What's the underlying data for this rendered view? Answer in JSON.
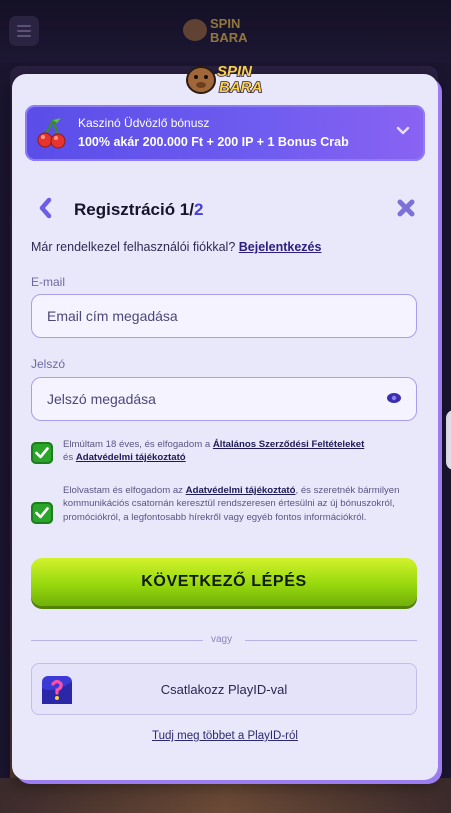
{
  "brand": {
    "logo_text_1": "SPIN",
    "logo_text_2": "BARA"
  },
  "bonus": {
    "title": "Kaszinó Üdvözlő bónusz",
    "description": "100% akár 200.000 Ft + 200 IP + 1 Bonus Crab"
  },
  "registration": {
    "title": "Regisztráció 1/",
    "step_total": "2",
    "have_account_text": "Már rendelkezel felhasználói fiókkal? ",
    "login_link": "Bejelentkezés"
  },
  "email": {
    "label": "E-mail",
    "placeholder": "Email cím megadása"
  },
  "password": {
    "label": "Jelszó",
    "placeholder": "Jelszó megadása"
  },
  "consent1": {
    "checked": true,
    "text_1": "Elmúltam 18 éves, és elfogadom a ",
    "link_1": "Általános Szerződési Feltételeket",
    "text_2": " és ",
    "link_2": "Adatvédelmi tájékoztató"
  },
  "consent2": {
    "checked": true,
    "text_1": "Elolvastam és elfogadom az ",
    "link_1": "Adatvédelmi tájékoztató",
    "text_2": ", és szeretnék bármilyen kommunikációs csatornán keresztül rendszeresen értesülni az új bónuszokról, promóciókról, a legfontosabb hírekről vagy egyéb fontos információkról."
  },
  "next_button": "KÖVETKEZŐ LÉPÉS",
  "divider_text": "vagy",
  "playid": {
    "button_label": "Csatlakozz PlayID-val",
    "learn_more": "Tudj meg többet a PlayID-ról"
  },
  "colors": {
    "accent": "#5a4de8",
    "modal_bg": "#e9e8fb",
    "primary_button": "#97d80d",
    "checkbox": "#2aa52a"
  },
  "icons": {
    "bonus": "cherry-icon",
    "expand": "chevron-down-icon",
    "back": "chevron-left-icon",
    "close": "close-icon",
    "reveal": "eye-icon",
    "playid": "playid-icon",
    "menu": "menu-icon"
  }
}
